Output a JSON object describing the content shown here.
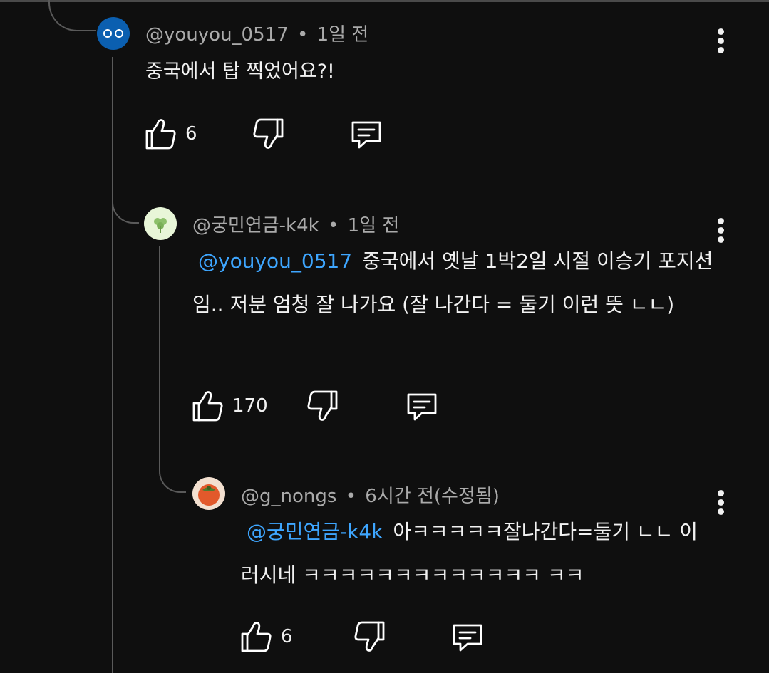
{
  "comments": [
    {
      "author": "@youyou_0517",
      "sep": "•",
      "time": "1일 전",
      "mention": "",
      "text": "중국에서 탑 찍었어요?!",
      "likes": "6"
    },
    {
      "author": "@궁민연금-k4k",
      "sep": "•",
      "time": "1일 전",
      "mention": "@youyou_0517",
      "text": "중국에서 옛날 1박2일 시절 이승기 포지션임.. 저분 엄청 잘 나가요 (잘 나간다 = 둘기 이런 뜻 ㄴㄴ)",
      "likes": "170"
    },
    {
      "author": "@g_nongs",
      "sep": "•",
      "time": "6시간 전(수정됨)",
      "mention": "@궁민연금-k4k",
      "text": "아ㅋㅋㅋㅋㅋ잘나간다=둘기 ㄴㄴ 이러시네 ㅋㅋㅋㅋㅋㅋㅋㅋㅋㅋㅋㅋㅋ ㅋㅋ",
      "likes": "6"
    }
  ],
  "icons": [
    "like-icon",
    "dislike-icon",
    "reply-icon",
    "more-options-icon"
  ],
  "colors": {
    "background": "#0f0f0f",
    "text": "#f1f1f1",
    "meta": "#aaaaaa",
    "mention": "#3ea6ff",
    "thread_line": "#5a5a5a"
  }
}
